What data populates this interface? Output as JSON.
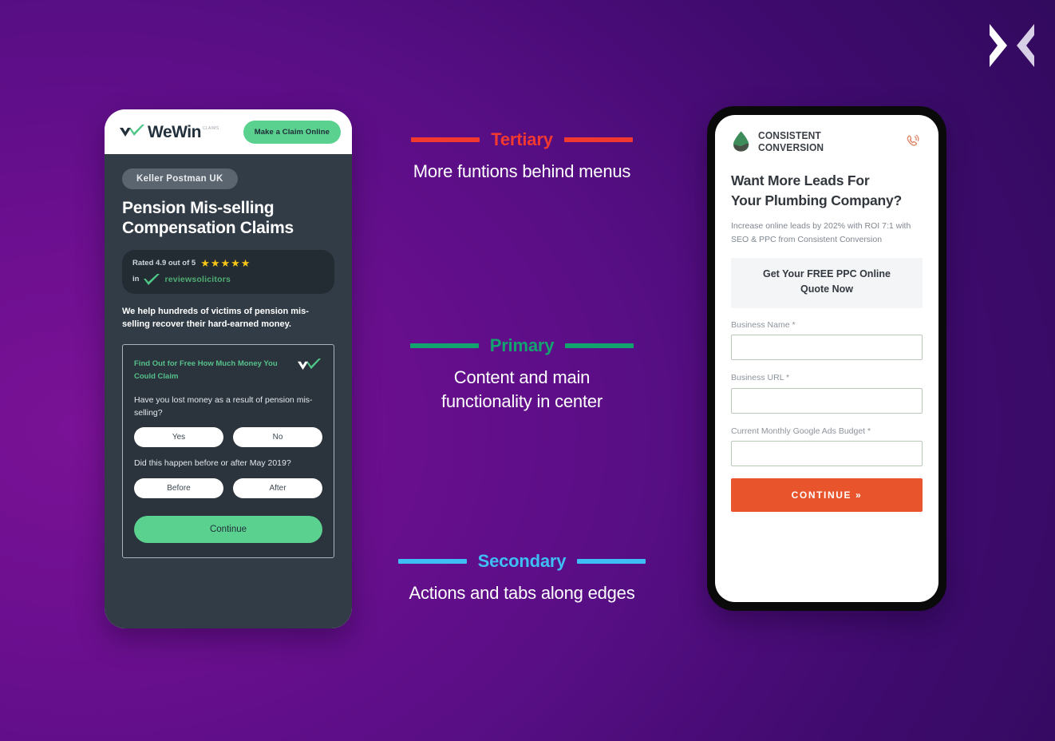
{
  "brand": {
    "logo_icon": "x-mark-logo",
    "bg_from": "#6b0f8f",
    "bg_to": "#2a0a55"
  },
  "annotations": [
    {
      "id": "tertiary",
      "title": "Tertiary",
      "description": "More funtions behind menus",
      "color": "#f2392f"
    },
    {
      "id": "primary",
      "title": "Primary",
      "description_line1": "Content and main",
      "description_line2": "functionality in center",
      "color": "#13a36f"
    },
    {
      "id": "secondary",
      "title": "Secondary",
      "description": "Actions and tabs along edges",
      "color": "#3fbdf5"
    }
  ],
  "phone_left": {
    "name": "wewin-pension-claims-mockup",
    "topbar": {
      "logo_icon": "double-check-logo",
      "logo_text": "WeWin",
      "logo_superscript": "CLAIMS",
      "cta_label": "Make a Claim Online",
      "cta_color": "#5bd18f"
    },
    "hero": {
      "tag": "Keller Postman UK",
      "headline_line1": "Pension Mis-selling",
      "headline_line2": "Compensation Claims",
      "rating_text": "Rated 4.9 out of 5",
      "stars": "★★★★★",
      "rating_prefix": "in",
      "rating_source": "reviewsolicitors",
      "rating_check_icon": "green-check-icon",
      "body": "We help hundreds of victims of pension mis-selling recover their hard-earned money."
    },
    "form": {
      "heading": "Find Out for Free How Much Money You Could Claim",
      "heading_icon": "double-check-icon",
      "question1": "Have you lost money as a result of pension mis-selling?",
      "question1_options": [
        "Yes",
        "No"
      ],
      "question2": "Did this happen before or after May 2019?",
      "question2_options": [
        "Before",
        "After"
      ],
      "submit_label": "Continue"
    }
  },
  "phone_right": {
    "name": "consistent-conversion-ppc-mockup",
    "topbar": {
      "logo_icon": "water-drop-logo",
      "logo_text": "CONSISTENT CONVERSION",
      "call_icon": "phone-ring-icon",
      "call_icon_color": "#e88a6a"
    },
    "hero": {
      "headline_line1": "Want More Leads For",
      "headline_line2": "Your Plumbing Company?",
      "subtext": "Increase online leads by 202% with ROI 7:1 with SEO & PPC from Consistent Conversion"
    },
    "form": {
      "title_line1": "Get Your FREE PPC Online",
      "title_line2": "Quote Now",
      "fields": [
        {
          "label": "Business Name *",
          "value": ""
        },
        {
          "label": "Business URL *",
          "value": ""
        },
        {
          "label": "Current Monthly Google Ads Budget *",
          "value": ""
        }
      ],
      "submit_label": "CONTINUE »",
      "submit_color": "#e8552c"
    }
  }
}
